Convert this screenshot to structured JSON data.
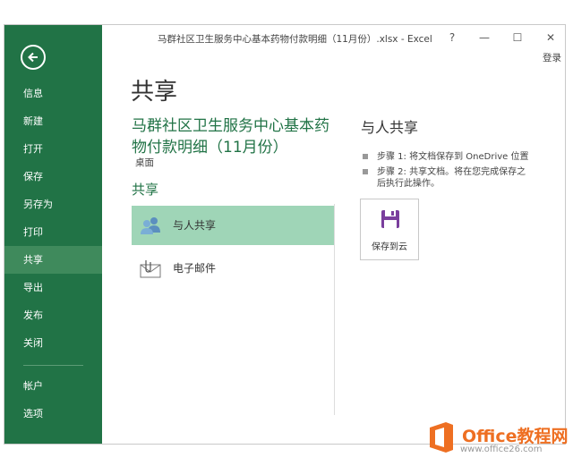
{
  "window": {
    "title": "马群社区卫生服务中心基本药物付款明细（11月份）.xlsx - Excel",
    "help": "?",
    "minimize": "—",
    "maximize": "☐",
    "close": "✕",
    "login": "登录"
  },
  "sidebar": {
    "items": [
      {
        "label": "信息"
      },
      {
        "label": "新建"
      },
      {
        "label": "打开"
      },
      {
        "label": "保存"
      },
      {
        "label": "另存为"
      },
      {
        "label": "打印"
      },
      {
        "label": "共享"
      },
      {
        "label": "导出"
      },
      {
        "label": "发布"
      },
      {
        "label": "关闭"
      },
      {
        "label": "帐户"
      },
      {
        "label": "选项"
      }
    ],
    "active": "共享"
  },
  "main": {
    "title": "共享",
    "doc_title_line1": "马群社区卫生服务中心基本药",
    "doc_title_line2": "物付款明细（11月份）",
    "doc_location": "桌面",
    "section_title": "共享",
    "options": [
      {
        "label": "与人共享"
      },
      {
        "label": "电子邮件"
      }
    ]
  },
  "right": {
    "title": "与人共享",
    "step1": "步骤 1: 将文档保存到 OneDrive 位置",
    "step2_line1": "步骤 2: 共享文档。将在您完成保存之",
    "step2_line2": "后执行此操作。",
    "save_button": "保存到云"
  },
  "watermark": {
    "text": "Office教程网",
    "url": "www.office26.com"
  },
  "colors": {
    "accent": "#217346",
    "selected": "#9fd5b7",
    "watermark": "#ee6f22"
  }
}
